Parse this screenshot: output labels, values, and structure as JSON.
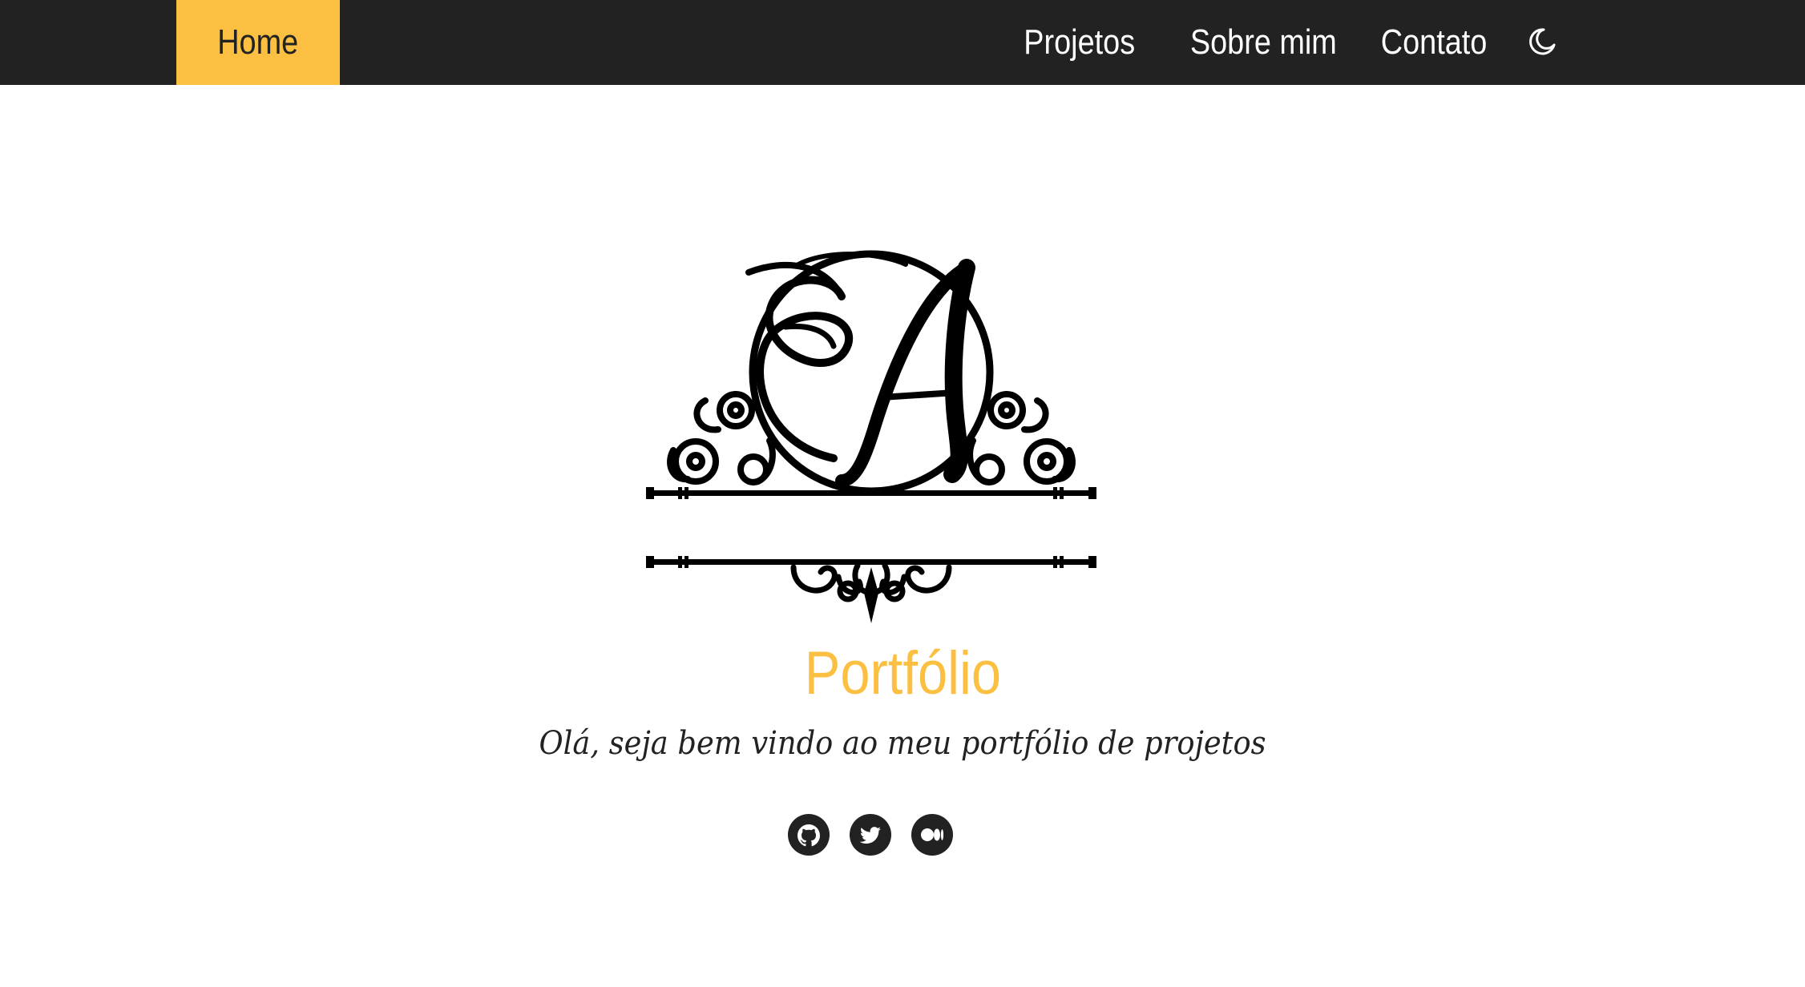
{
  "nav": {
    "home": "Home",
    "projetos": "Projetos",
    "sobre": "Sobre mim",
    "contato": "Contato",
    "theme_icon": "moon-icon"
  },
  "hero": {
    "logo_letter": "A",
    "title": "Portfólio",
    "subtitle": "Olá, seja bem vindo ao meu portfólio de projetos"
  },
  "social": [
    {
      "name": "github",
      "icon": "github-icon"
    },
    {
      "name": "twitter",
      "icon": "twitter-icon"
    },
    {
      "name": "medium",
      "icon": "medium-icon"
    }
  ],
  "colors": {
    "accent": "#fbc041",
    "navbar": "#222222",
    "text": "#222222",
    "background": "#ffffff"
  }
}
